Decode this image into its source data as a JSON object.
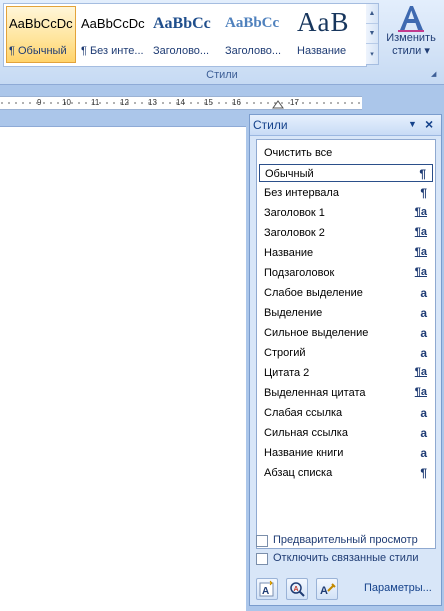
{
  "ribbon": {
    "group_label": "Стили",
    "quick_styles": [
      {
        "sample": "AaBbCcDc",
        "caption": "¶ Обычный",
        "selected": true
      },
      {
        "sample": "AaBbCcDc",
        "caption": "¶ Без инте..."
      },
      {
        "sample": "AaBbCc",
        "caption": "Заголово..."
      },
      {
        "sample": "AaBbCc",
        "caption": "Заголово..."
      },
      {
        "sample": "AaB",
        "caption": "Название"
      }
    ],
    "change_styles": {
      "line1": "Изменить",
      "line2": "стили ▾"
    },
    "accent_color": "#e3a33a"
  },
  "ruler": {
    "numbers": [
      "9",
      "10",
      "11",
      "12",
      "13",
      "14",
      "15",
      "16",
      "17"
    ]
  },
  "styles_pane": {
    "title": "Стили",
    "menu_glyph": "▼",
    "close_glyph": "×",
    "items": [
      {
        "name": "Очистить все",
        "icon": ""
      },
      {
        "name": "Обычный",
        "icon": "¶",
        "selected": true
      },
      {
        "name": "Без интервала",
        "icon": "¶"
      },
      {
        "name": "Заголовок 1",
        "icon": "¶a"
      },
      {
        "name": "Заголовок 2",
        "icon": "¶a"
      },
      {
        "name": "Название",
        "icon": "¶a"
      },
      {
        "name": "Подзаголовок",
        "icon": "¶a"
      },
      {
        "name": "Слабое выделение",
        "icon": "a"
      },
      {
        "name": "Выделение",
        "icon": "a"
      },
      {
        "name": "Сильное выделение",
        "icon": "a"
      },
      {
        "name": "Строгий",
        "icon": "a"
      },
      {
        "name": "Цитата 2",
        "icon": "¶a"
      },
      {
        "name": "Выделенная цитата",
        "icon": "¶a"
      },
      {
        "name": "Слабая ссылка",
        "icon": "a"
      },
      {
        "name": "Сильная ссылка",
        "icon": "a"
      },
      {
        "name": "Название книги",
        "icon": "a"
      },
      {
        "name": "Абзац списка",
        "icon": "¶"
      }
    ],
    "options": {
      "preview_label": "Предварительный просмотр",
      "preview_checked": false,
      "disable_linked_label": "Отключить связанные стили",
      "disable_linked_checked": false
    },
    "buttons": {
      "new_style_icon": "new-style-icon",
      "style_inspector_icon": "style-inspector-icon",
      "manage_styles_icon": "manage-styles-icon"
    },
    "params_link": "Параметры..."
  }
}
